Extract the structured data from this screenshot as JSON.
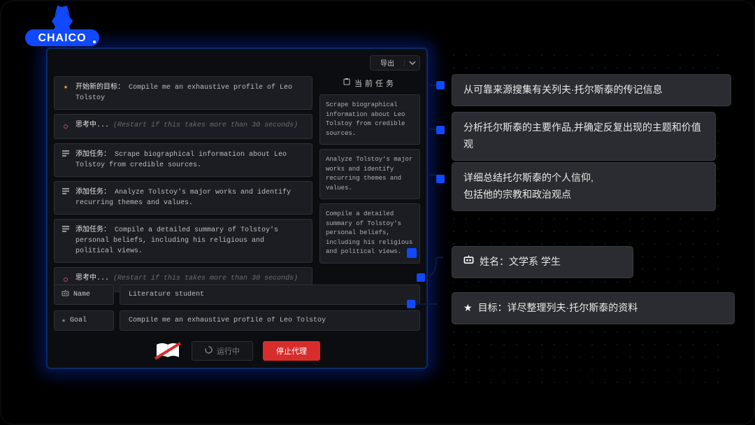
{
  "logo_text": "CHAICO",
  "export": {
    "label": "导出"
  },
  "log": {
    "items": [
      {
        "icon": "star",
        "prefix": "开始新的目标：",
        "text": "Compile me an exhaustive profile of Leo Tolstoy"
      },
      {
        "icon": "dot",
        "prefix": "思考中...",
        "dim": "(Restart if this takes more than 30 seconds)"
      },
      {
        "icon": "list",
        "prefix": "添加任务：",
        "text": "Scrape biographical information about Leo Tolstoy from credible sources."
      },
      {
        "icon": "list",
        "prefix": "添加任务：",
        "text": "Analyze Tolstoy's major works and identify recurring themes and values."
      },
      {
        "icon": "list",
        "prefix": "添加任务：",
        "text": "Compile a detailed summary of Tolstoy's personal beliefs, including his religious and political views."
      },
      {
        "icon": "dot",
        "prefix": "思考中...",
        "dim": "(Restart if this takes more than 30 seconds)"
      }
    ]
  },
  "tasks": {
    "heading": "当前任务",
    "items": [
      "Scrape biographical information about Leo Tolstoy from credible sources.",
      "Analyze Tolstoy's major works and identify recurring themes and values.",
      "Compile a detailed summary of Tolstoy's personal beliefs, including his religious and political views."
    ]
  },
  "form": {
    "name_label": "Name",
    "name_value": "Literature student",
    "goal_label": "Goal",
    "goal_value": "Compile me an exhaustive profile of Leo Tolstoy"
  },
  "buttons": {
    "running": "运行中",
    "stop": "停止代理"
  },
  "bubbles": {
    "b0": "从可靠来源搜集有关列夫·托尔斯泰的传记信息",
    "b1": "分析托尔斯泰的主要作品,并确定反复出现的主题和价值观",
    "b2": "详细总结托尔斯泰的个人信仰,\n包括他的宗教和政治观点",
    "b3": "姓名：文学系 学生",
    "b4": "目标：详尽整理列夫·托尔斯泰的资料"
  }
}
